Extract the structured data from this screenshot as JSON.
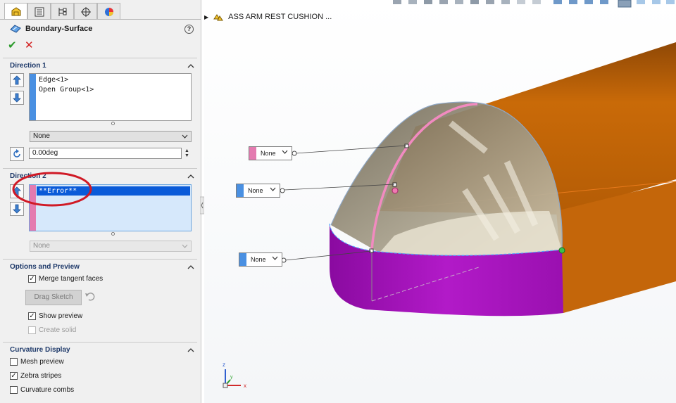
{
  "feature": {
    "title": "Boundary-Surface"
  },
  "direction1": {
    "title": "Direction 1",
    "selections": [
      "Edge<1>",
      "Open Group<1>"
    ],
    "tangent_option": "None",
    "draft_angle": "0.00deg",
    "bar_color": "#4a90e2"
  },
  "direction2": {
    "title": "Direction 2",
    "selections": [
      "**Error**"
    ],
    "tangent_option": "None",
    "bar_color": "#e47bb0"
  },
  "options": {
    "title": "Options and Preview",
    "merge_tangent_faces": "Merge tangent faces",
    "drag_sketch": "Drag Sketch",
    "show_preview": "Show preview",
    "create_solid": "Create solid"
  },
  "curvature": {
    "title": "Curvature Display",
    "mesh_preview": "Mesh preview",
    "zebra_stripes": "Zebra stripes",
    "curvature_combs": "Curvature combs"
  },
  "graphics": {
    "document_name": "ASS ARM REST CUSHION ...",
    "callouts": [
      "None",
      "None",
      "None"
    ],
    "triad": {
      "x": "x",
      "y": "y",
      "z": "z"
    }
  },
  "colors": {
    "accent_blue": "#4a90e2",
    "accent_pink": "#e47bb0",
    "surface_orange": "#c96a08",
    "surface_purple": "#a010b8",
    "error_circle": "#d01a26",
    "selected_highlight": "#0a5ad8"
  }
}
